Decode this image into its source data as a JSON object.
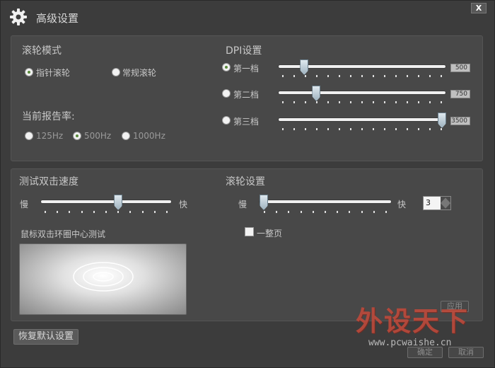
{
  "window": {
    "title": "高级设置",
    "close_label": "X"
  },
  "wheel_mode": {
    "title": "滚轮模式",
    "options": [
      {
        "label": "指针滚轮",
        "selected": true
      },
      {
        "label": "常规滚轮",
        "selected": false
      }
    ]
  },
  "report_rate": {
    "title": "当前报告率:",
    "options": [
      {
        "label": "125Hz",
        "selected": false
      },
      {
        "label": "500Hz",
        "selected": true
      },
      {
        "label": "1000Hz",
        "selected": false
      }
    ]
  },
  "dpi": {
    "title": "DPI设置",
    "levels": [
      {
        "label": "第一档",
        "selected": true,
        "value": "500",
        "position_fraction": 0.09
      },
      {
        "label": "第二档",
        "selected": false,
        "value": "750",
        "position_fraction": 0.17
      },
      {
        "label": "第三档",
        "selected": false,
        "value": "3500",
        "position_fraction": 1.0
      }
    ]
  },
  "double_click": {
    "title": "测试双击速度",
    "slow_label": "慢",
    "fast_label": "快",
    "position_fraction": 0.6,
    "test_label": "鼠标双击环圈中心测试"
  },
  "wheel_settings": {
    "title": "滚轮设置",
    "slow_label": "慢",
    "fast_label": "快",
    "position_fraction": 0.0,
    "lines_value": "3",
    "page_label": "一整页",
    "page_checked": false
  },
  "buttons": {
    "reset": "恢复默认设置",
    "apply": "应用",
    "ok": "确定",
    "cancel": "取消"
  },
  "watermark": {
    "text": "外设天下",
    "url": "www.pcwaishe.cn"
  },
  "colors": {
    "background": "#3c3c3c",
    "panel": "#484848",
    "radio_dot": "#5a8a3a",
    "watermark": "#c54a3a"
  }
}
